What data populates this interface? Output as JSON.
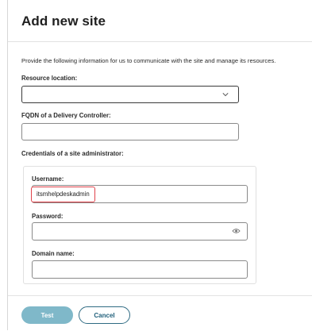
{
  "dialog": {
    "title": "Add new site",
    "intro": "Provide the following information for us to communicate with the site and manage its resources."
  },
  "form": {
    "resource_location_label": "Resource location:",
    "resource_location_value": "",
    "fqdn_label": "FQDN of a Delivery Controller:",
    "fqdn_value": "",
    "credentials_label": "Credentials of a site administrator:",
    "username_label": "Username:",
    "username_value": "itsmhelpdeskadmin",
    "password_label": "Password:",
    "password_value": "",
    "domain_label": "Domain name:",
    "domain_value": ""
  },
  "footer": {
    "test_label": "Test",
    "cancel_label": "Cancel"
  },
  "colors": {
    "highlight_border": "#e0424a",
    "test_button_bg": "#7fb8c9",
    "cancel_button_border": "#2f6b83"
  },
  "icons": {
    "dropdown": "chevron-down-icon",
    "password_toggle": "eye-icon"
  }
}
